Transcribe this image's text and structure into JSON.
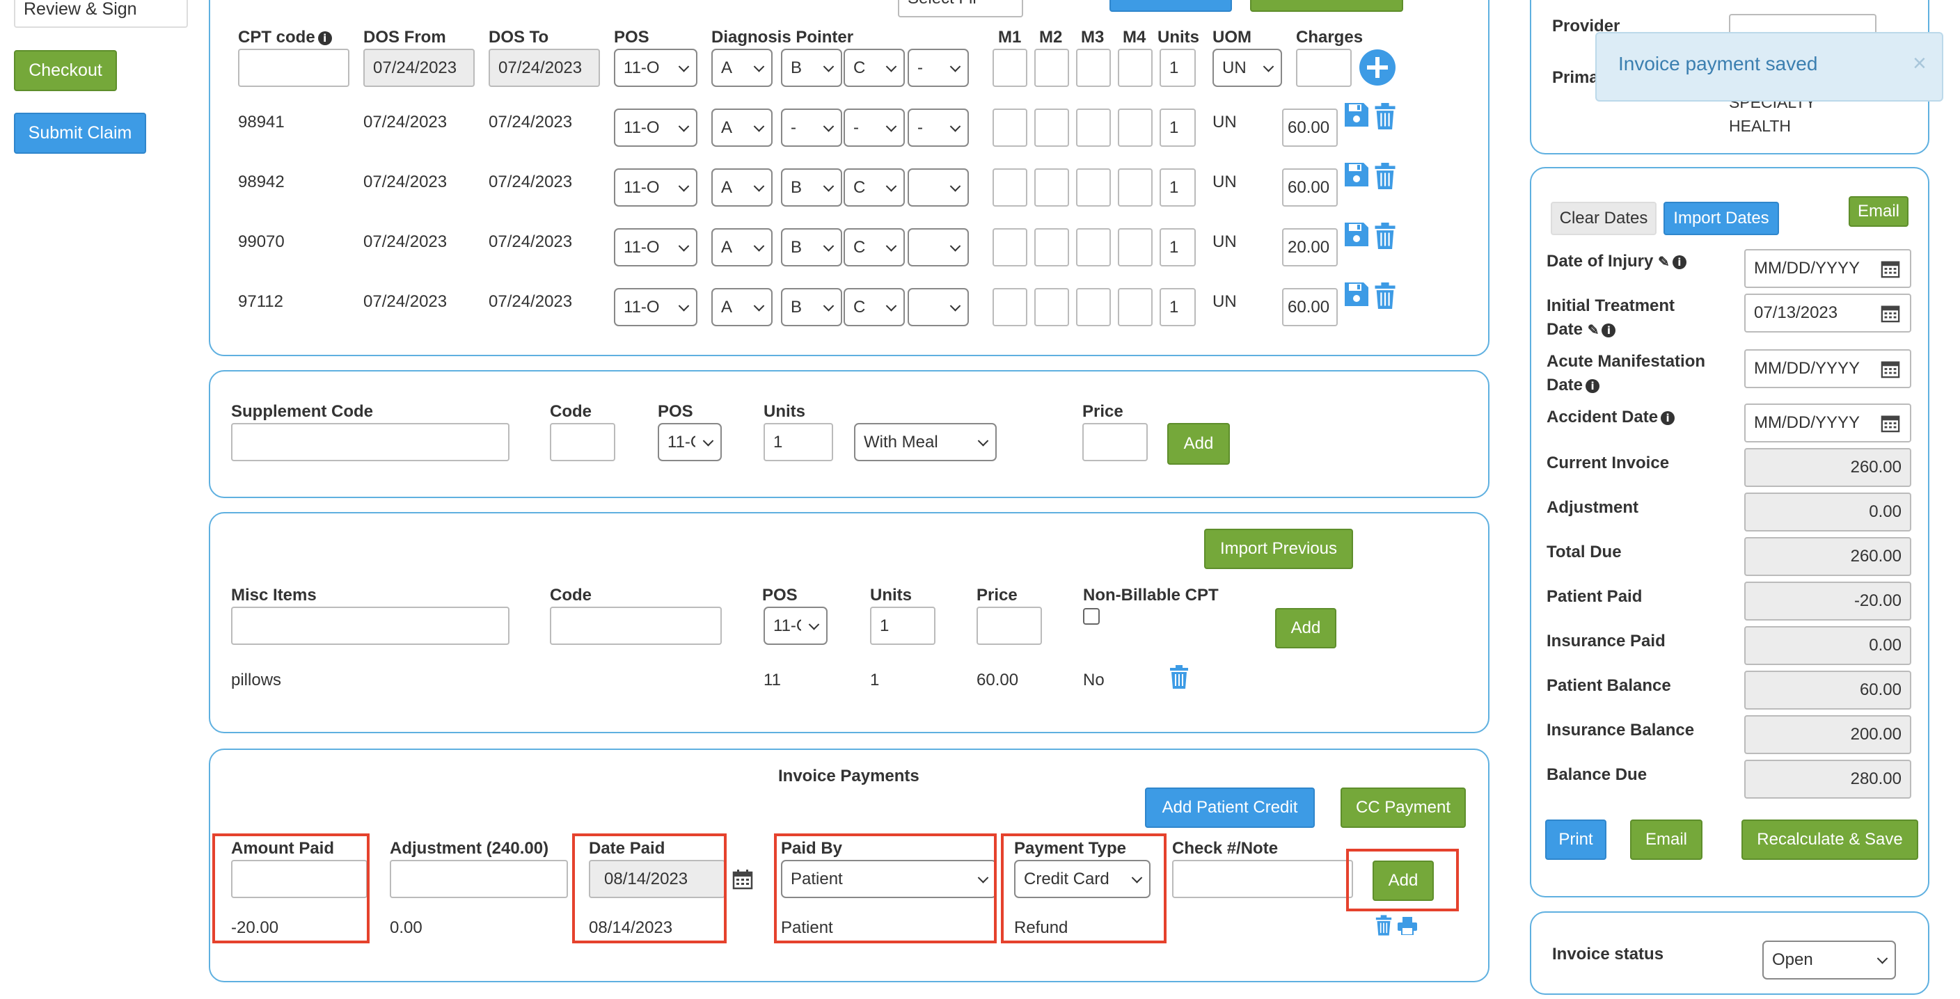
{
  "left_nav": {
    "review_sign": "Review & Sign",
    "checkout": "Checkout",
    "submit_claim": "Submit Claim"
  },
  "cpt": {
    "headers": {
      "cpt_code": "CPT code",
      "dos_from": "DOS From",
      "dos_to": "DOS To",
      "pos": "POS",
      "diag_pointer": "Diagnosis Pointer",
      "m1": "M1",
      "m2": "M2",
      "m3": "M3",
      "m4": "M4",
      "units": "Units",
      "uom": "UOM",
      "charges": "Charges"
    },
    "new_row": {
      "cpt_code": "",
      "dos_from": "07/24/2023",
      "dos_to": "07/24/2023",
      "pos": "11-O",
      "diag": [
        "A",
        "B",
        "C",
        "-"
      ],
      "units": "1",
      "uom": "UN",
      "charges": ""
    },
    "rows": [
      {
        "code": "98941",
        "from": "07/24/2023",
        "to": "07/24/2023",
        "pos": "11-O",
        "diag": [
          "A",
          "-",
          "-",
          "-"
        ],
        "units": "1",
        "uom": "UN",
        "charges": "60.00"
      },
      {
        "code": "98942",
        "from": "07/24/2023",
        "to": "07/24/2023",
        "pos": "11-O",
        "diag": [
          "A",
          "B",
          "C",
          ""
        ],
        "units": "1",
        "uom": "UN",
        "charges": "60.00"
      },
      {
        "code": "99070",
        "from": "07/24/2023",
        "to": "07/24/2023",
        "pos": "11-O",
        "diag": [
          "A",
          "B",
          "C",
          ""
        ],
        "units": "1",
        "uom": "UN",
        "charges": "20.00"
      },
      {
        "code": "97112",
        "from": "07/24/2023",
        "to": "07/24/2023",
        "pos": "11-O",
        "diag": [
          "A",
          "B",
          "C",
          ""
        ],
        "units": "1",
        "uom": "UN",
        "charges": "60.00"
      }
    ],
    "top_buttons": {
      "select": "Select Fil",
      "b1": "",
      "b2": ""
    }
  },
  "supplement": {
    "supplement_code_label": "Supplement Code",
    "code_label": "Code",
    "pos_label": "POS",
    "units_label": "Units",
    "price_label": "Price",
    "pos_value": "11-C",
    "units_value": "1",
    "meal_value": "With Meal",
    "add": "Add"
  },
  "misc": {
    "import_previous": "Import Previous",
    "misc_label": "Misc Items",
    "code_label": "Code",
    "pos_label": "POS",
    "units_label": "Units",
    "price_label": "Price",
    "non_billable_label": "Non-Billable CPT",
    "pos_value": "11-C",
    "units_value": "1",
    "add": "Add",
    "item": {
      "name": "pillows",
      "pos": "11",
      "units": "1",
      "price": "60.00",
      "non_billable": "No"
    }
  },
  "payments": {
    "title": "Invoice Payments",
    "add_patient_credit": "Add Patient Credit",
    "cc_payment": "CC Payment",
    "amount_paid_label": "Amount Paid",
    "adjustment_label": "Adjustment (240.00)",
    "date_paid_label": "Date Paid",
    "paid_by_label": "Paid By",
    "payment_type_label": "Payment Type",
    "check_note_label": "Check #/Note",
    "date_paid_value": "08/14/2023",
    "paid_by_value": "Patient",
    "payment_type_value": "Credit Card",
    "add": "Add",
    "row": {
      "amount": "-20.00",
      "adjustment": "0.00",
      "date": "08/14/2023",
      "paid_by": "Patient",
      "type": "Refund"
    }
  },
  "right_top": {
    "provider_label": "Provider",
    "primary_label": "Prima",
    "specialty_line1": "SPECIALTY",
    "specialty_line2": "HEALTH"
  },
  "toast": {
    "message": "Invoice payment saved",
    "close": "×"
  },
  "summary": {
    "clear_dates": "Clear Dates",
    "import_dates": "Import Dates",
    "email_top": "Email",
    "date_of_injury_label": "Date of Injury",
    "initial_treatment_label_1": "Initial Treatment",
    "initial_treatment_label_2": "Date",
    "acute_label_1": "Acute Manifestation",
    "acute_label_2": "Date",
    "accident_label": "Accident Date",
    "date_placeholder": "MM/DD/YYYY",
    "initial_treatment_value": "07/13/2023",
    "fields": [
      {
        "label": "Current Invoice",
        "value": "260.00"
      },
      {
        "label": "Adjustment",
        "value": "0.00"
      },
      {
        "label": "Total Due",
        "value": "260.00"
      },
      {
        "label": "Patient Paid",
        "value": "-20.00"
      },
      {
        "label": "Insurance Paid",
        "value": "0.00"
      },
      {
        "label": "Patient Balance",
        "value": "60.00"
      },
      {
        "label": "Insurance Balance",
        "value": "200.00"
      },
      {
        "label": "Balance Due",
        "value": "280.00"
      }
    ],
    "print": "Print",
    "email": "Email",
    "recalc": "Recalculate & Save"
  },
  "status": {
    "label": "Invoice status",
    "value": "Open"
  },
  "colors": {
    "accent_blue": "#3d9be5",
    "accent_green": "#75a83a",
    "panel_border": "#5fb0e0",
    "highlight_red": "#e5422d",
    "toast_bg": "#dcecf6"
  }
}
